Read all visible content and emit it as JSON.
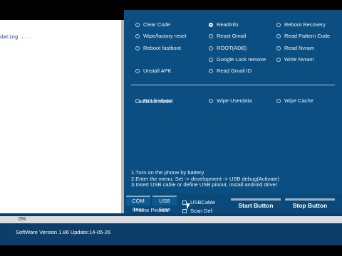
{
  "log": {
    "lines": "dating ..."
  },
  "options": {
    "col1": [
      "Clear Code",
      "Wipe/factory reset",
      "Reboot fastboot",
      "Unstall APK"
    ],
    "col2": [
      "ReadInfo",
      "Reset Gmail",
      "ROOT(ADB)",
      "Google Lock remove",
      "Read Gmail ID"
    ],
    "col3": [
      "Reboot Recovery",
      "Read Pattern Code",
      "Read Nvram",
      "Write Nvram"
    ],
    "selected": "ReadInfo"
  },
  "fastboot": {
    "title": "FastBoot mode:",
    "options": [
      "Exit fastboot",
      "Wipe Userdata",
      "Wipe Cache"
    ]
  },
  "instructions": "1.Turn on the phone by battery\n2.Enter the menu: Set -> development -> USB debug(Activate)\n3.Insert USB cable or define USB pinout, install android driver",
  "controls": {
    "com_scan_label": "COM Scan",
    "usb_scan_label": "USB Scan",
    "usb_cable_label": "USBCable",
    "phone_pinouts_label": "Phone Pinouts",
    "scan_def_label": "Scan Def",
    "start_label": "Start Button",
    "stop_label": "Stop Button"
  },
  "progress": {
    "text": "0%",
    "value": 0
  },
  "status": {
    "version": "SoftWare Version 1.86  Update:14-05-26"
  },
  "colors": {
    "panel": "#0b4f82",
    "status_bar": "#0d3d6b",
    "progress_fill": "#4fa0e6"
  }
}
